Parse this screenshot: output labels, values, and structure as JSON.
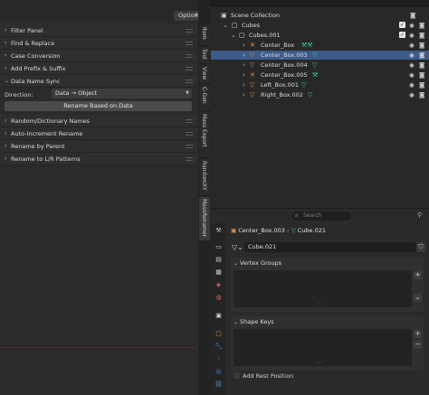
{
  "left_panel": {
    "options_label": "Options",
    "sections_top": [
      {
        "label": "Filter Panel"
      },
      {
        "label": "Find & Replace"
      },
      {
        "label": "Case Conversion"
      },
      {
        "label": "Add Prefix & Suffix"
      },
      {
        "label": "Data Name Sync"
      }
    ],
    "direction_label": "Direction:",
    "direction_value": "Data → Object",
    "rename_button": "Rename Based on Data",
    "sections_bottom": [
      {
        "label": "Random/Dictionary Names"
      },
      {
        "label": "Auto-Increment Rename"
      },
      {
        "label": "Rename by Parent"
      },
      {
        "label": "Rename to L/R Patterns"
      }
    ]
  },
  "vertical_tabs": [
    "Item",
    "Tool",
    "View",
    "C-Gen",
    "Mass Export",
    "RandomXY",
    "MassRenamer"
  ],
  "outliner": {
    "collection": "Scene Collection",
    "rows": [
      {
        "name": "Cubes"
      },
      {
        "name": "Cubes.001"
      },
      {
        "name": "Center_Box"
      },
      {
        "name": "Center_Box.003"
      },
      {
        "name": "Center_Box.004"
      },
      {
        "name": "Center_Box.005"
      },
      {
        "name": "Left_Box.001"
      },
      {
        "name": "Right_Box.002"
      }
    ]
  },
  "properties": {
    "search_placeholder": "Search",
    "object_name": "Center_Box.003",
    "data_name": "Cube.021",
    "mesh_field": "Cube.021",
    "vertex_groups": "Vertex Groups",
    "shape_keys": "Shape Keys",
    "add_rest_position": "Add Rest Position"
  },
  "colors": {
    "selected_row": "#3c5a8a",
    "object_icon": "#e8954a",
    "mesh_icon": "#3fd08d"
  }
}
